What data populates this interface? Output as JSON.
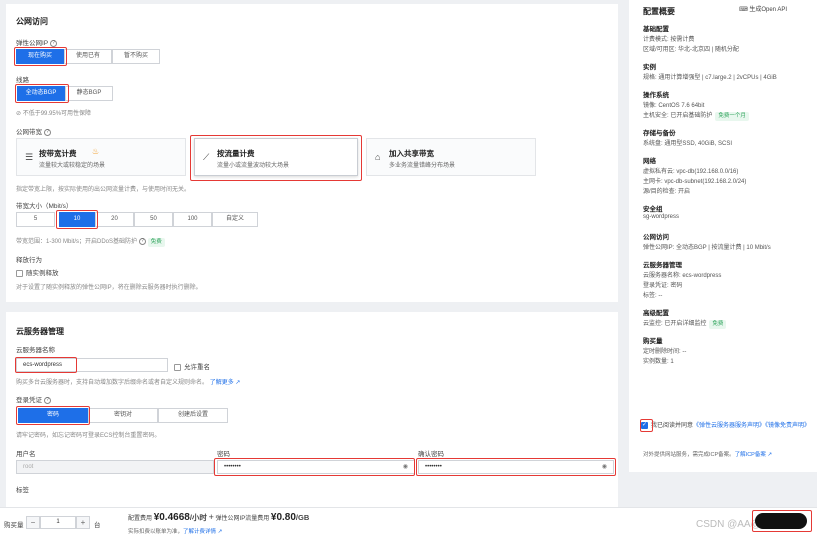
{
  "public_network": {
    "title": "公网访问",
    "eip_label": "弹性公网IP",
    "eip_options": [
      "现在购买",
      "使用已有",
      "暂不购买"
    ],
    "line_label": "线路",
    "line_options": [
      "全动态BGP",
      "静态BGP"
    ],
    "line_hint": "不低于99.95%可用性保障",
    "bandwidth_label": "公网带宽",
    "billing_cards": [
      {
        "title": "按带宽计费",
        "desc": "流量较大或较稳定的场景"
      },
      {
        "title": "按流量计费",
        "desc": "流量小或流量波动较大场景"
      },
      {
        "title": "加入共享带宽",
        "desc": "多业务流量错峰分布场景"
      }
    ],
    "billing_note": "指定带宽上限，按实际使用的出公网流量计费，与使用时间无关。",
    "bw_size_label": "带宽大小（Mbit/s）",
    "bw_options": [
      "5",
      "10",
      "20",
      "50",
      "100",
      "自定义"
    ],
    "bw_range": "带宽范围：1-300 Mbit/s；开启DDoS基础防护",
    "free_badge": "免费",
    "release_label": "释放行为",
    "release_checkbox": "随实例释放",
    "release_hint": "对于设置了随实例释放的弹性公网IP，将在删除云服务器时执行删除。"
  },
  "server_mgmt": {
    "title": "云服务器管理",
    "name_label": "云服务器名称",
    "name_value": "ecs-wordpress",
    "allow_dup": "允许重名",
    "batch_hint": "购买多台云服务器时，支持自动增加数字后缀命名或者自定义规则命名。",
    "learn_more": "了解更多",
    "cred_label": "登录凭证",
    "cred_options": [
      "密码",
      "密钥对",
      "创建后设置"
    ],
    "cred_hint": "请牢记密码，如忘记密码可登录ECS控制台重置密码。",
    "user_label": "用户名",
    "user_value": "root",
    "pwd_label": "密码",
    "pwd_value": "••••••••",
    "confirm_label": "确认密码",
    "confirm_value": "••••••••",
    "tag_label": "标签"
  },
  "summary": {
    "title": "配置概要",
    "openapi": "生成Open API",
    "sections": [
      {
        "title": "基础配置",
        "rows": [
          "计费模式: 按需计费",
          "区域/可用区: 华北-北京四 | 随机分配"
        ]
      },
      {
        "title": "实例",
        "rows": [
          "规格: 通用计算增强型 | c7.large.2 | 2vCPUs | 4GiB"
        ]
      },
      {
        "title": "操作系统",
        "rows": [
          "镜像: CentOS 7.6 64bit",
          "主机安全: 已开启基础防护"
        ]
      },
      {
        "title": "存储与备份",
        "rows": [
          "系统盘: 通用型SSD, 40GiB, SCSI"
        ]
      },
      {
        "title": "网络",
        "rows": [
          "虚拟私有云: vpc-db(192.168.0.0/16)",
          "主网卡: vpc-db-subnet(192.168.2.0/24)",
          "源/目的检查: 开启"
        ]
      },
      {
        "title": "安全组",
        "rows": [
          "sg-wordpress"
        ]
      },
      {
        "title": "公网访问",
        "rows": [
          "弹性公网IP: 全动态BGP | 按流量计费 | 10 Mbit/s"
        ]
      },
      {
        "title": "云服务器管理",
        "rows": [
          "云服务器名称: ecs-wordpress",
          "登录凭证: 密码",
          "标签: --"
        ]
      },
      {
        "title": "高级配置",
        "rows": [
          "云监控: 已开启详细监控"
        ]
      },
      {
        "title": "购买量",
        "rows": [
          "定时删除时间: --",
          "实例数量: 1"
        ]
      }
    ],
    "hss_badge": "免费一个月",
    "monitor_badge": "免费",
    "agree_text": "我已阅读并同意",
    "agree_link1": "《弹性云服务器服务声明》",
    "agree_link2": "《镜像免责声明》",
    "icp_text": "对外提供网站服务，需完成ICP备案。",
    "icp_link": "了解ICP备案"
  },
  "bottom": {
    "qty_label": "购买量",
    "qty_value": "1",
    "qty_unit": "台",
    "fee_label": "配置费用",
    "fee_value": "¥0.4668",
    "fee_unit": "/小时",
    "plus": "+",
    "eip_fee_label": "弹性公网IP流量费用",
    "eip_fee_value": "¥0.80",
    "eip_fee_unit": "/GB",
    "fee_note": "实际扣费以账单为准，",
    "fee_link": "了解计费详情",
    "watermark": "CSDN @AA@峥"
  },
  "colors": {
    "primary": "#1e6fe8",
    "highlight": "#e53935",
    "free": "#2ea35b"
  }
}
